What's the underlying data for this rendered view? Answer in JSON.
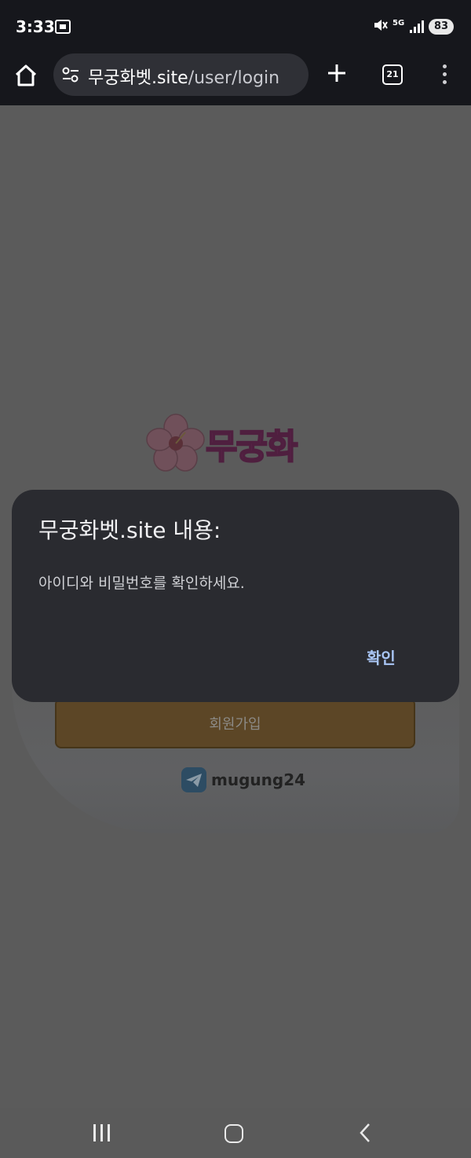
{
  "status_bar": {
    "time": "3:33",
    "network": "5G",
    "battery": "83",
    "icons": [
      "screen-record-icon",
      "mute-icon",
      "signal-icon",
      "battery-icon"
    ]
  },
  "browser": {
    "url_host": "무궁화벳.site",
    "url_path": "/user/login",
    "tab_count": "21",
    "icons": [
      "home-icon",
      "site-settings-icon",
      "new-tab-icon",
      "tabs-icon",
      "more-icon"
    ]
  },
  "page": {
    "logo_text": "무궁화",
    "signup_label": "회원가입",
    "telegram_handle": "mugung24"
  },
  "dialog": {
    "title": "무궁화벳.site 내용:",
    "message": "아이디와 비밀번호를 확인하세요.",
    "ok_label": "확인"
  },
  "nav_bar": {
    "icons": [
      "recent-apps-icon",
      "home-icon",
      "back-icon"
    ]
  },
  "colors": {
    "dialog_bg": "#2a2b30",
    "dialog_accent": "#a9c6f5",
    "toolbar_bg": "#16171c",
    "scrim": "#5a5a5a"
  }
}
